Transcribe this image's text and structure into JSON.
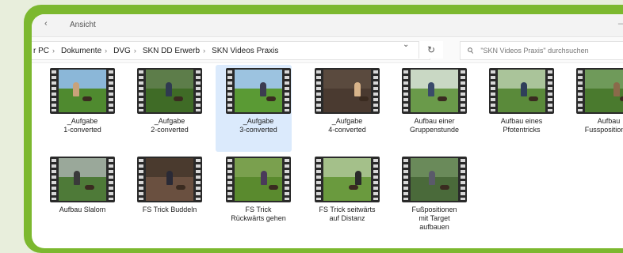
{
  "window": {
    "title": "Ansicht"
  },
  "address_bar": {
    "crumbs": [
      "r PC",
      "Dokumente",
      "DVG",
      "SKN DD Erwerb",
      "SKN Videos Praxis"
    ],
    "search_placeholder": "\"SKN Videos Praxis\" durchsuchen"
  },
  "icons": {
    "back": "chevron-left-icon",
    "dropdown": "chevron-down-icon",
    "refresh": "refresh-icon",
    "search": "search-icon"
  },
  "files": [
    {
      "name": "_Aufgabe\n1-converted",
      "selected": false
    },
    {
      "name": "_Aufgabe\n2-converted",
      "selected": false
    },
    {
      "name": "_Aufgabe\n3-converted",
      "selected": true
    },
    {
      "name": "_Aufgabe\n4-converted",
      "selected": false
    },
    {
      "name": "Aufbau einer\nGruppenstunde",
      "selected": false
    },
    {
      "name": "Aufbau eines\nPfotentricks",
      "selected": false
    },
    {
      "name": "Aufbau\nFusspositionen",
      "selected": false
    },
    {
      "name": "Aufbau Slalom",
      "selected": false
    },
    {
      "name": "FS Trick Buddeln",
      "selected": false
    },
    {
      "name": "FS Trick\nRückwärts gehen",
      "selected": false
    },
    {
      "name": "FS Trick seitwärts\nauf Distanz",
      "selected": false
    },
    {
      "name": "Fußpositionen\nmit Target\naufbauen",
      "selected": false
    }
  ],
  "colors": {
    "accent_frame": "#7cb82f",
    "selection": "#dbeafc"
  }
}
